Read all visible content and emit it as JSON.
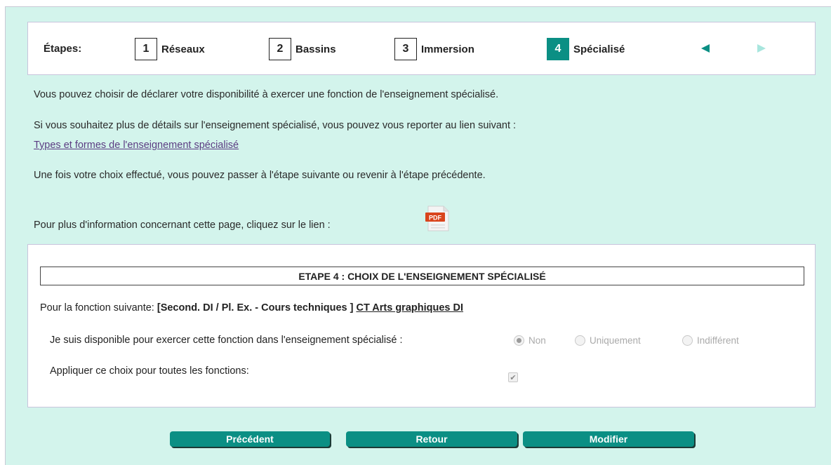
{
  "steps": {
    "label": "Étapes:",
    "items": [
      {
        "num": "1",
        "label": "Réseaux"
      },
      {
        "num": "2",
        "label": "Bassins"
      },
      {
        "num": "3",
        "label": "Immersion"
      },
      {
        "num": "4",
        "label": "Spécialisé"
      }
    ],
    "active_index": 3
  },
  "intro": {
    "line1": "Vous pouvez choisir de déclarer votre disponibilité à exercer une fonction de l'enseignement spécialisé.",
    "line2": "Si vous souhaitez plus de détails sur l'enseignement spécialisé, vous pouvez vous reporter au lien suivant :",
    "link": "Types et formes de l'enseignement spécialisé",
    "line3": "Une fois votre choix effectué, vous pouvez passer à l'étape suivante ou revenir à l'étape précédente.",
    "line4": "Pour plus d'information concernant cette page, cliquez sur le lien :",
    "pdf_label": "PDF"
  },
  "panel": {
    "title": "ETAPE 4 : CHOIX DE L'ENSEIGNEMENT SPÉCIALISÉ",
    "fonction_prefix": "Pour la fonction suivante:",
    "fonction_code": "[Second. DI / Pl. Ex. - Cours techniques ]",
    "fonction_link": "CT Arts graphiques DI",
    "dispo_label": "Je suis disponible pour exercer cette fonction dans l'enseignement spécialisé :",
    "options": [
      "Non",
      "Uniquement",
      "Indifférent"
    ],
    "selected_option": "Non",
    "appliquer_label": "Appliquer ce choix pour toutes les fonctions:",
    "appliquer_checked": true
  },
  "buttons": {
    "precedent": "Précédent",
    "retour": "Retour",
    "modifier": "Modifier"
  },
  "colors": {
    "background": "#d3f4ec",
    "accent": "#0b8f84",
    "link": "#5b3c82"
  }
}
